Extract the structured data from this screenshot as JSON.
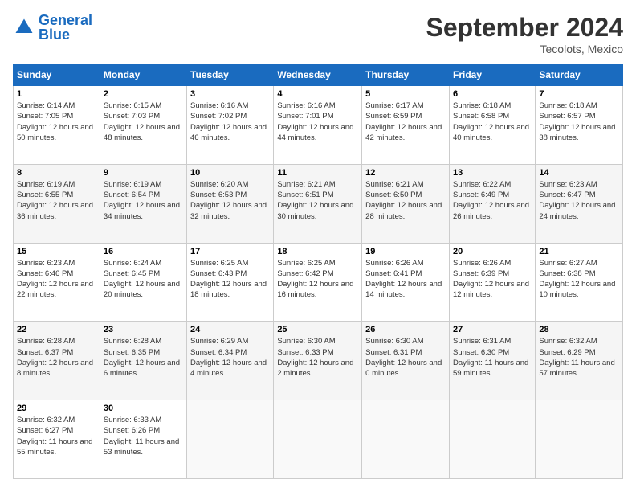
{
  "logo": {
    "text_general": "General",
    "text_blue": "Blue"
  },
  "header": {
    "month": "September 2024",
    "location": "Tecolots, Mexico"
  },
  "days_of_week": [
    "Sunday",
    "Monday",
    "Tuesday",
    "Wednesday",
    "Thursday",
    "Friday",
    "Saturday"
  ],
  "weeks": [
    [
      {
        "day": "1",
        "sunrise": "6:14 AM",
        "sunset": "7:05 PM",
        "daylight": "12 hours and 50 minutes."
      },
      {
        "day": "2",
        "sunrise": "6:15 AM",
        "sunset": "7:03 PM",
        "daylight": "12 hours and 48 minutes."
      },
      {
        "day": "3",
        "sunrise": "6:16 AM",
        "sunset": "7:02 PM",
        "daylight": "12 hours and 46 minutes."
      },
      {
        "day": "4",
        "sunrise": "6:16 AM",
        "sunset": "7:01 PM",
        "daylight": "12 hours and 44 minutes."
      },
      {
        "day": "5",
        "sunrise": "6:17 AM",
        "sunset": "6:59 PM",
        "daylight": "12 hours and 42 minutes."
      },
      {
        "day": "6",
        "sunrise": "6:18 AM",
        "sunset": "6:58 PM",
        "daylight": "12 hours and 40 minutes."
      },
      {
        "day": "7",
        "sunrise": "6:18 AM",
        "sunset": "6:57 PM",
        "daylight": "12 hours and 38 minutes."
      }
    ],
    [
      {
        "day": "8",
        "sunrise": "6:19 AM",
        "sunset": "6:55 PM",
        "daylight": "12 hours and 36 minutes."
      },
      {
        "day": "9",
        "sunrise": "6:19 AM",
        "sunset": "6:54 PM",
        "daylight": "12 hours and 34 minutes."
      },
      {
        "day": "10",
        "sunrise": "6:20 AM",
        "sunset": "6:53 PM",
        "daylight": "12 hours and 32 minutes."
      },
      {
        "day": "11",
        "sunrise": "6:21 AM",
        "sunset": "6:51 PM",
        "daylight": "12 hours and 30 minutes."
      },
      {
        "day": "12",
        "sunrise": "6:21 AM",
        "sunset": "6:50 PM",
        "daylight": "12 hours and 28 minutes."
      },
      {
        "day": "13",
        "sunrise": "6:22 AM",
        "sunset": "6:49 PM",
        "daylight": "12 hours and 26 minutes."
      },
      {
        "day": "14",
        "sunrise": "6:23 AM",
        "sunset": "6:47 PM",
        "daylight": "12 hours and 24 minutes."
      }
    ],
    [
      {
        "day": "15",
        "sunrise": "6:23 AM",
        "sunset": "6:46 PM",
        "daylight": "12 hours and 22 minutes."
      },
      {
        "day": "16",
        "sunrise": "6:24 AM",
        "sunset": "6:45 PM",
        "daylight": "12 hours and 20 minutes."
      },
      {
        "day": "17",
        "sunrise": "6:25 AM",
        "sunset": "6:43 PM",
        "daylight": "12 hours and 18 minutes."
      },
      {
        "day": "18",
        "sunrise": "6:25 AM",
        "sunset": "6:42 PM",
        "daylight": "12 hours and 16 minutes."
      },
      {
        "day": "19",
        "sunrise": "6:26 AM",
        "sunset": "6:41 PM",
        "daylight": "12 hours and 14 minutes."
      },
      {
        "day": "20",
        "sunrise": "6:26 AM",
        "sunset": "6:39 PM",
        "daylight": "12 hours and 12 minutes."
      },
      {
        "day": "21",
        "sunrise": "6:27 AM",
        "sunset": "6:38 PM",
        "daylight": "12 hours and 10 minutes."
      }
    ],
    [
      {
        "day": "22",
        "sunrise": "6:28 AM",
        "sunset": "6:37 PM",
        "daylight": "12 hours and 8 minutes."
      },
      {
        "day": "23",
        "sunrise": "6:28 AM",
        "sunset": "6:35 PM",
        "daylight": "12 hours and 6 minutes."
      },
      {
        "day": "24",
        "sunrise": "6:29 AM",
        "sunset": "6:34 PM",
        "daylight": "12 hours and 4 minutes."
      },
      {
        "day": "25",
        "sunrise": "6:30 AM",
        "sunset": "6:33 PM",
        "daylight": "12 hours and 2 minutes."
      },
      {
        "day": "26",
        "sunrise": "6:30 AM",
        "sunset": "6:31 PM",
        "daylight": "12 hours and 0 minutes."
      },
      {
        "day": "27",
        "sunrise": "6:31 AM",
        "sunset": "6:30 PM",
        "daylight": "11 hours and 59 minutes."
      },
      {
        "day": "28",
        "sunrise": "6:32 AM",
        "sunset": "6:29 PM",
        "daylight": "11 hours and 57 minutes."
      }
    ],
    [
      {
        "day": "29",
        "sunrise": "6:32 AM",
        "sunset": "6:27 PM",
        "daylight": "11 hours and 55 minutes."
      },
      {
        "day": "30",
        "sunrise": "6:33 AM",
        "sunset": "6:26 PM",
        "daylight": "11 hours and 53 minutes."
      },
      null,
      null,
      null,
      null,
      null
    ]
  ]
}
